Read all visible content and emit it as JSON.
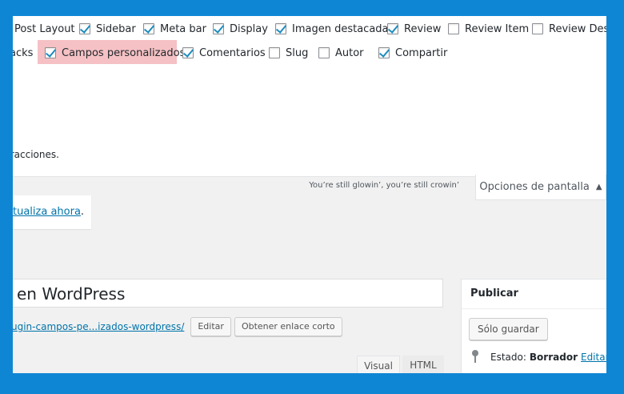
{
  "screen_options": {
    "row1": [
      {
        "label": "Post Layout",
        "checked": null
      },
      {
        "label": "Sidebar",
        "checked": true
      },
      {
        "label": "Meta bar",
        "checked": true
      },
      {
        "label": "Display",
        "checked": true
      },
      {
        "label": "Imagen destacada",
        "checked": true
      },
      {
        "label": "Review",
        "checked": true
      },
      {
        "label": "Review Item",
        "checked": false
      },
      {
        "label": "Review Desc",
        "checked": false
      }
    ],
    "row2": [
      {
        "label": "acks",
        "checked": null
      },
      {
        "label": "Campos personalizados",
        "checked": true
      },
      {
        "label": "Comentarios",
        "checked": true
      },
      {
        "label": "Slug",
        "checked": false
      },
      {
        "label": "Autor",
        "checked": false
      },
      {
        "label": "Compartir",
        "checked": true
      }
    ],
    "instructions": "tracciones."
  },
  "quote": "You’re still glowin’, you’re still crowin’",
  "screen_options_tab": "Opciones de pantalla",
  "notice": {
    "link": "tualiza ahora",
    "suffix": "."
  },
  "post": {
    "title": "en WordPress",
    "permalink": "ugin-campos-pe...izados-wordpress/",
    "edit_button": "Editar",
    "shortlink_button": "Obtener enlace corto"
  },
  "editor_tabs": {
    "visual": "Visual",
    "html": "HTML"
  },
  "publish": {
    "title": "Publicar",
    "save_button": "Sólo guardar",
    "status_label": "Estado:",
    "status_value": "Borrador",
    "status_edit": "Editar"
  }
}
